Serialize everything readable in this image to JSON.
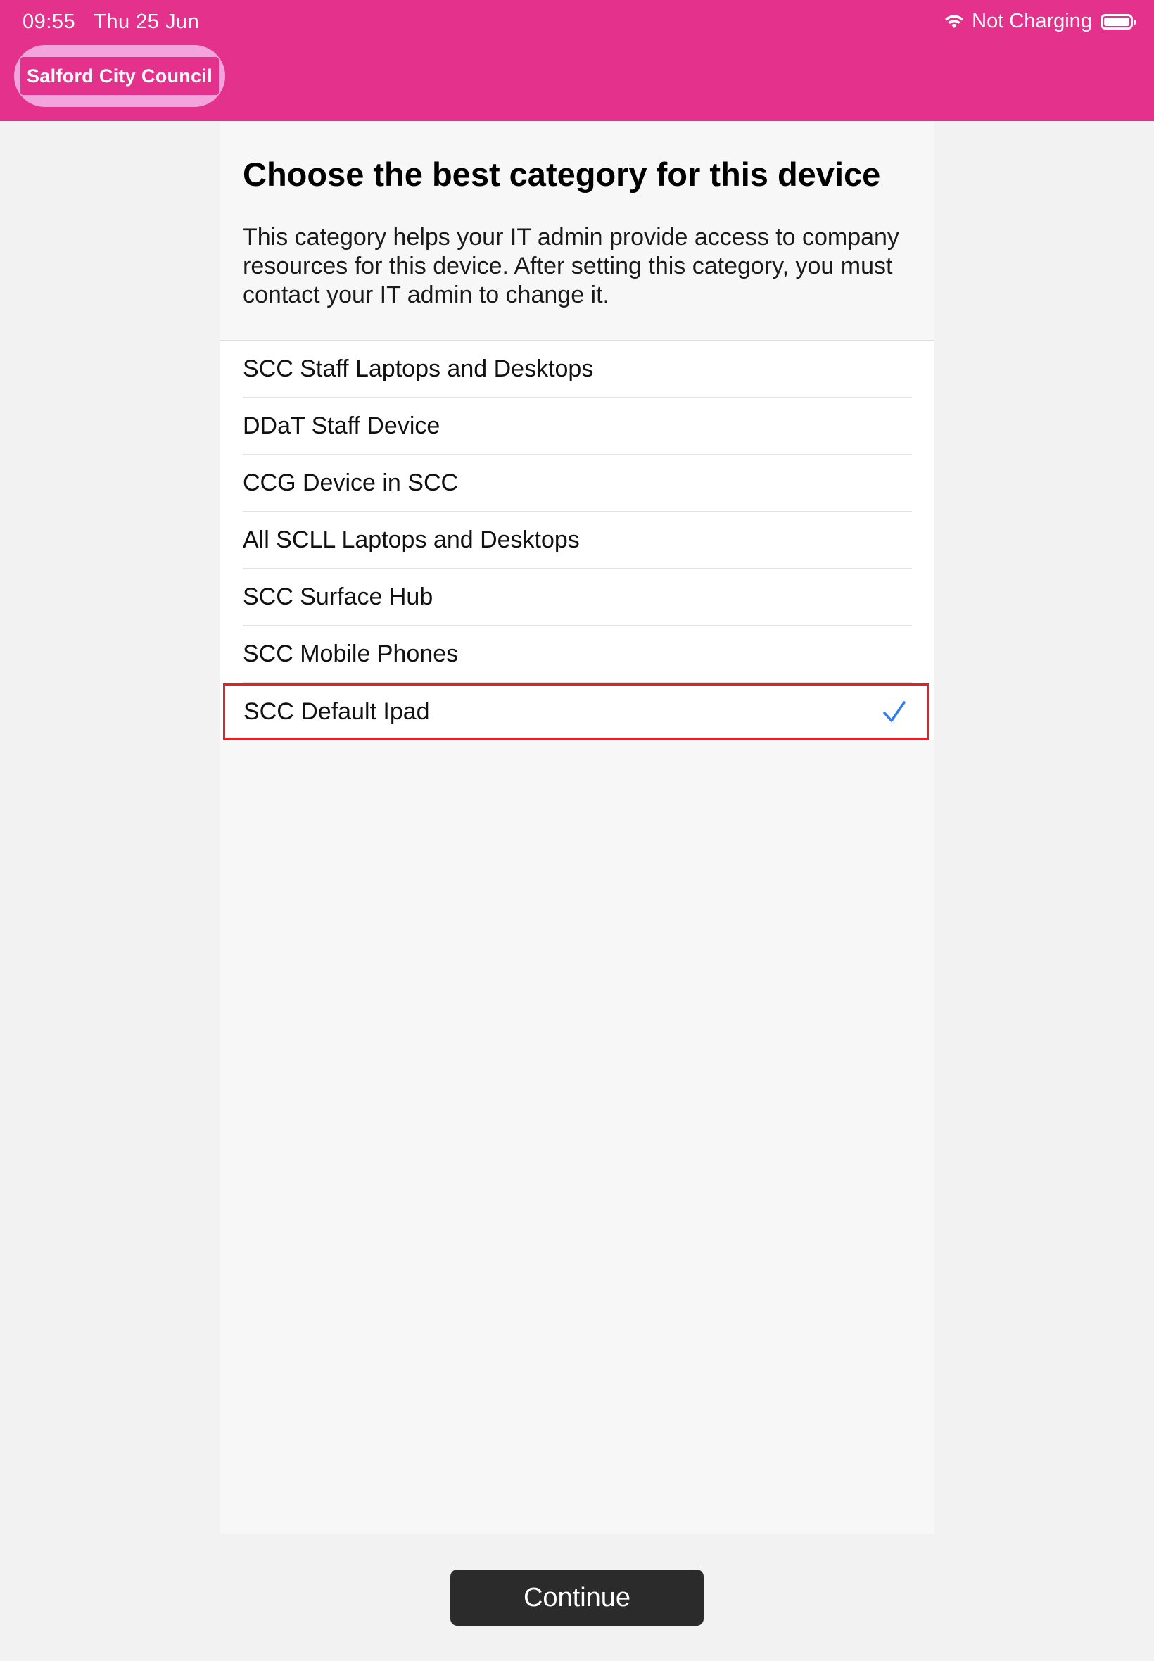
{
  "status_bar": {
    "time": "09:55",
    "date": "Thu 25 Jun",
    "charging": "Not Charging"
  },
  "header": {
    "logo_text": "Salford City Council",
    "brand_color": "#e4318c"
  },
  "main": {
    "title": "Choose the best category for this device",
    "description": "This category helps your IT admin provide access to company resources for this device. After setting this category, you must contact your IT admin to change it.",
    "categories": [
      {
        "label": "SCC Staff Laptops and Desktops",
        "selected": false
      },
      {
        "label": "DDaT Staff Device",
        "selected": false
      },
      {
        "label": "CCG Device in SCC",
        "selected": false
      },
      {
        "label": "All SCLL Laptops and Desktops",
        "selected": false
      },
      {
        "label": "SCC Surface Hub",
        "selected": false
      },
      {
        "label": "SCC Mobile Phones",
        "selected": false
      },
      {
        "label": "SCC Default Ipad",
        "selected": true
      }
    ],
    "check_icon": "checkmark-icon",
    "check_color": "#2f7cf6",
    "highlight_color": "#e02128"
  },
  "footer": {
    "continue_label": "Continue"
  }
}
